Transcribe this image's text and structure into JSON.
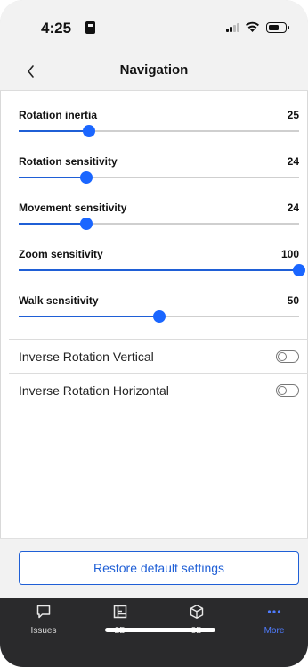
{
  "status_bar": {
    "time": "4:25"
  },
  "header": {
    "title": "Navigation",
    "back_icon": "chevron-left-icon"
  },
  "sliders": [
    {
      "label": "Rotation inertia",
      "value": "25",
      "percent": 25
    },
    {
      "label": "Rotation sensitivity",
      "value": "24",
      "percent": 24
    },
    {
      "label": "Movement sensitivity",
      "value": "24",
      "percent": 24
    },
    {
      "label": "Zoom sensitivity",
      "value": "100",
      "percent": 100
    },
    {
      "label": "Walk sensitivity",
      "value": "50",
      "percent": 50
    }
  ],
  "toggles": [
    {
      "label": "Inverse Rotation Vertical",
      "on": false
    },
    {
      "label": "Inverse Rotation Horizontal",
      "on": false
    }
  ],
  "restore_button": {
    "label": "Restore default settings"
  },
  "tabs": [
    {
      "label": "Issues",
      "icon": "chat-bubble-icon",
      "active": false
    },
    {
      "label": "2D",
      "icon": "floorplan-icon",
      "active": false
    },
    {
      "label": "3D",
      "icon": "cube-icon",
      "active": false
    },
    {
      "label": "More",
      "icon": "more-dots-icon",
      "active": true
    }
  ],
  "colors": {
    "accent": "#1a66ff",
    "tab_bar": "#2a2a2c",
    "active_tab": "#4f7cff"
  }
}
